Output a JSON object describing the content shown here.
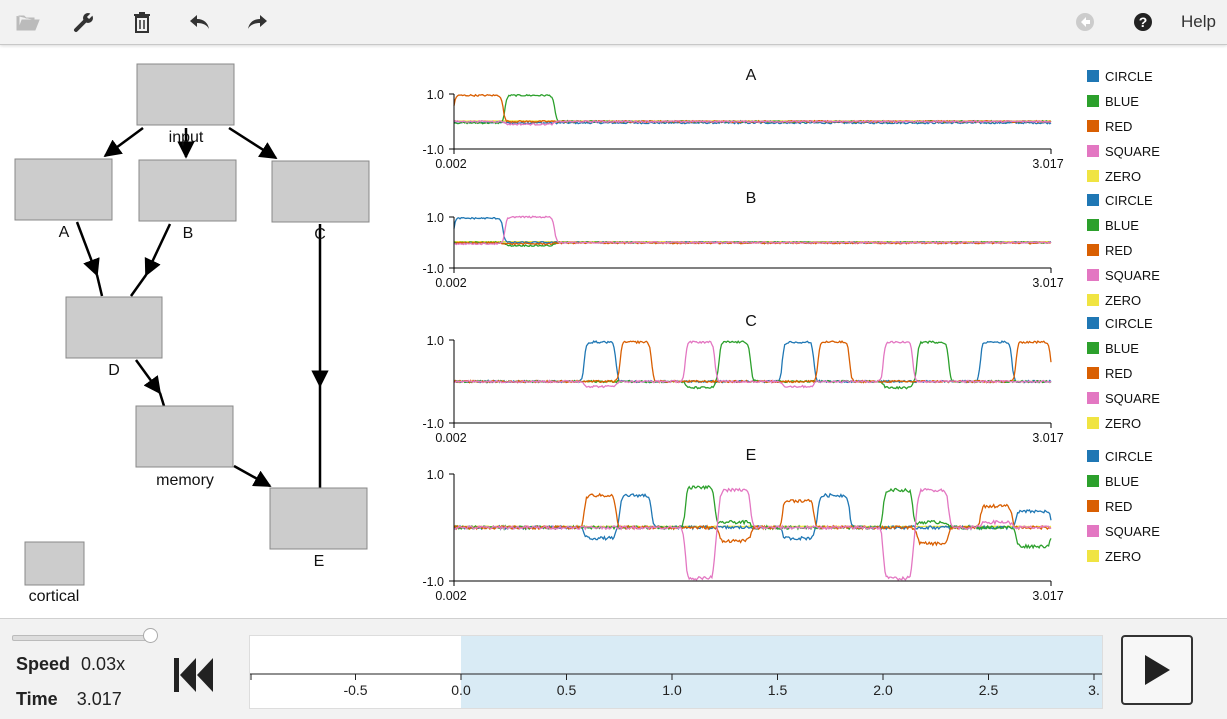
{
  "toolbar": {
    "help_label": "Help",
    "icons": [
      "folder-open-icon",
      "wrench-icon",
      "trash-icon",
      "undo-icon",
      "redo-icon",
      "back-circle-icon",
      "question-circle-icon"
    ]
  },
  "graph": {
    "nodes": [
      {
        "id": "input",
        "label": "input"
      },
      {
        "id": "A",
        "label": "A"
      },
      {
        "id": "B",
        "label": "B"
      },
      {
        "id": "C",
        "label": "C"
      },
      {
        "id": "D",
        "label": "D"
      },
      {
        "id": "memory",
        "label": "memory"
      },
      {
        "id": "E",
        "label": "E"
      },
      {
        "id": "cortical",
        "label": "cortical"
      }
    ],
    "edges": [
      [
        "input",
        "A"
      ],
      [
        "input",
        "B"
      ],
      [
        "input",
        "C"
      ],
      [
        "A",
        "D"
      ],
      [
        "B",
        "D"
      ],
      [
        "D",
        "memory"
      ],
      [
        "memory",
        "E"
      ],
      [
        "C",
        "E"
      ]
    ]
  },
  "chart_data": [
    {
      "type": "line",
      "title": "A",
      "xlim": [
        0.002,
        3.017
      ],
      "ylim": [
        -1.0,
        1.0
      ],
      "xticks": [
        "0.002",
        "3.017"
      ],
      "yticks": [
        "1.0",
        "-1.0"
      ],
      "legend": [
        "CIRCLE",
        "BLUE",
        "RED",
        "SQUARE",
        "ZERO"
      ],
      "colors": [
        "#1f77b4",
        "#2ca02c",
        "#d95f02",
        "#e377c2",
        "#f0e442"
      ]
    },
    {
      "type": "line",
      "title": "B",
      "xlim": [
        0.002,
        3.017
      ],
      "ylim": [
        -1.0,
        1.0
      ],
      "xticks": [
        "0.002",
        "3.017"
      ],
      "yticks": [
        "1.0",
        "-1.0"
      ],
      "legend": [
        "CIRCLE",
        "BLUE",
        "RED",
        "SQUARE",
        "ZERO"
      ],
      "colors": [
        "#1f77b4",
        "#2ca02c",
        "#d95f02",
        "#e377c2",
        "#f0e442"
      ]
    },
    {
      "type": "line",
      "title": "C",
      "xlim": [
        0.002,
        3.017
      ],
      "ylim": [
        -1.0,
        1.0
      ],
      "xticks": [
        "0.002",
        "3.017"
      ],
      "yticks": [
        "1.0",
        "-1.0"
      ],
      "legend": [
        "CIRCLE",
        "BLUE",
        "RED",
        "SQUARE",
        "ZERO"
      ],
      "colors": [
        "#1f77b4",
        "#2ca02c",
        "#d95f02",
        "#e377c2",
        "#f0e442"
      ]
    },
    {
      "type": "line",
      "title": "E",
      "xlim": [
        0.002,
        3.017
      ],
      "ylim": [
        -1.0,
        1.0
      ],
      "xticks": [
        "0.002",
        "3.017"
      ],
      "yticks": [
        "1.0",
        "-1.0"
      ],
      "legend": [
        "CIRCLE",
        "BLUE",
        "RED",
        "SQUARE",
        "ZERO"
      ],
      "colors": [
        "#1f77b4",
        "#2ca02c",
        "#d95f02",
        "#e377c2",
        "#f0e442"
      ]
    }
  ],
  "controls": {
    "speed_label": "Speed",
    "speed_value": "0.03x",
    "time_label": "Time",
    "time_value": "3.017",
    "slider_level": 1.0,
    "timeline": {
      "ticks": [
        "-0.5",
        "0.0",
        "0.5",
        "1.0",
        "1.5",
        "2.0",
        "2.5",
        "3."
      ],
      "tick_values": [
        -0.5,
        0.0,
        0.5,
        1.0,
        1.5,
        2.0,
        2.5,
        3.0
      ],
      "range": [
        -1.0,
        3.0
      ],
      "selection": [
        0.0,
        3.017
      ]
    }
  }
}
